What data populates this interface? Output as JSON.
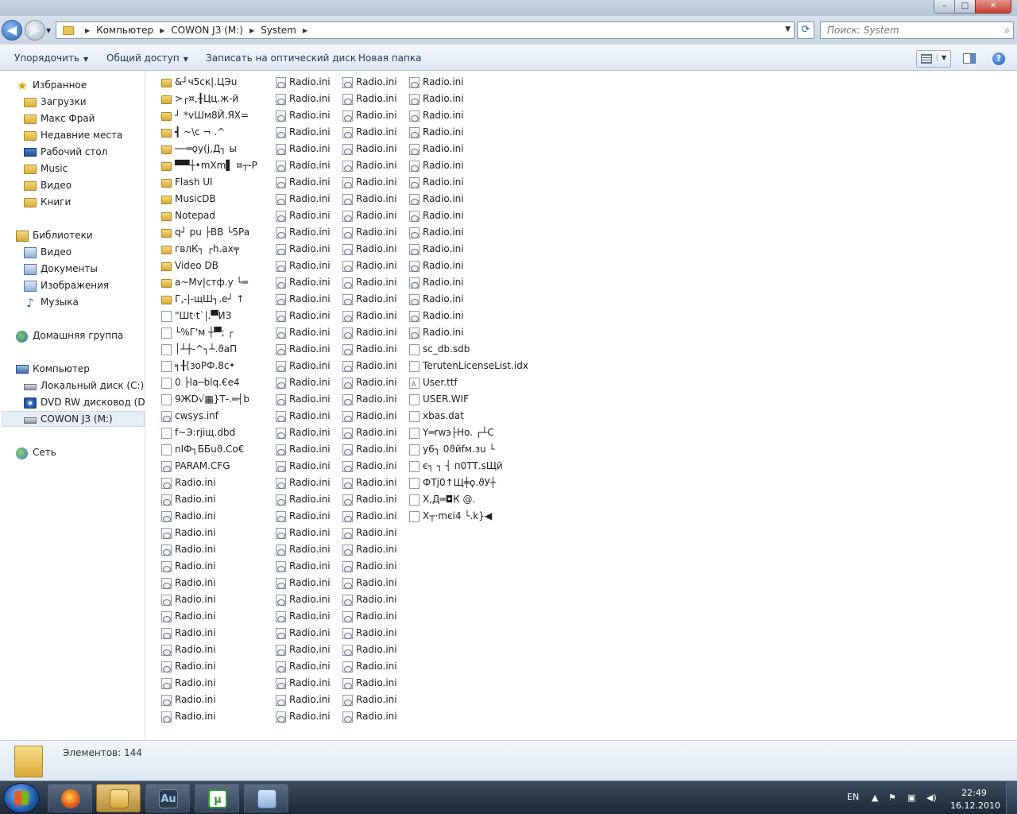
{
  "window": {
    "minimize_label": "–",
    "maximize_label": "□",
    "close_label": "✕"
  },
  "address": {
    "back_label": "◀",
    "forward_label": "▶",
    "crumbs": [
      "Компьютер",
      "COWON J3 (M:)",
      "System"
    ],
    "refresh_label": "⟳",
    "search_placeholder": "Поиск: System"
  },
  "toolbar": {
    "organize_label": "Упорядочить",
    "share_label": "Общий доступ",
    "burn_label": "Записать на оптический диск",
    "new_folder_label": "Новая папка",
    "help_label": "?"
  },
  "nav": {
    "favorites": {
      "label": "Избранное",
      "items": [
        "Загрузки",
        "Макс Фрай",
        "Недавние места",
        "Рабочий стол",
        "Music",
        "Видео",
        "Книги"
      ]
    },
    "libraries": {
      "label": "Библиотеки",
      "items": [
        "Видео",
        "Документы",
        "Изображения",
        "Музыка"
      ]
    },
    "homegroup": {
      "label": "Домашняя группа"
    },
    "computer": {
      "label": "Компьютер",
      "items": [
        "Локальный диск (C:)",
        "DVD RW дисковод (D:) C",
        "COWON J3 (M:)"
      ]
    },
    "network": {
      "label": "Сеть"
    }
  },
  "files": {
    "column1": [
      {
        "name": "&┘ч5ск|.ЦЭu",
        "type": "folder"
      },
      {
        "name": ">┌¤,╂Цц.ж-й",
        "type": "folder"
      },
      {
        "name": "┘ *vШм8Й.ЯХ=",
        "type": "folder"
      },
      {
        "name": "┫ ~\\с  ¬ .^",
        "type": "folder"
      },
      {
        "name": "──═ϙу(j,Д┐ ы",
        "type": "folder"
      },
      {
        "name": "▀▀┼•mXm▌ ¤┬-P",
        "type": "folder"
      },
      {
        "name": "Flash UI",
        "type": "folder"
      },
      {
        "name": "MusicDB",
        "type": "folder"
      },
      {
        "name": "Notepad",
        "type": "folder"
      },
      {
        "name": "q┘ pu ├BB └5Pa",
        "type": "folder"
      },
      {
        "name": "гвлК┐  ┌h.ах╤",
        "type": "folder"
      },
      {
        "name": "Video DB",
        "type": "folder"
      },
      {
        "name": "a~Mv|стф.у └═",
        "type": "folder"
      },
      {
        "name": "Г,-|-щШ┐.е┘ ↑",
        "type": "folder"
      },
      {
        "name": "\"Шt·t`|.▀ИЗ",
        "type": "doc"
      },
      {
        "name": "└%Г'м ┼▀; ┌",
        "type": "doc"
      },
      {
        "name": "│┴┼-^┐┴.ϑаП",
        "type": "doc"
      },
      {
        "name": "  ╕╂[зоРФ.8с•",
        "type": "doc"
      },
      {
        "name": "0 ├la─blq.€e4",
        "type": "doc"
      },
      {
        "name": "9ЖD√▦}Т-.═┤b",
        "type": "doc"
      },
      {
        "name": "cwsys.inf",
        "type": "cfg"
      },
      {
        "name": "f~Э:rjiщ.dbd",
        "type": "doc"
      },
      {
        "name": "nIФ┐ББuϑ.Со€",
        "type": "doc"
      },
      {
        "name": "PARAM.CFG",
        "type": "cfg"
      },
      {
        "name": "Radio.ini",
        "type": "cfg"
      },
      {
        "name": "Radio.ini",
        "type": "cfg"
      },
      {
        "name": "Radio.ini",
        "type": "cfg"
      },
      {
        "name": "Radio.ini",
        "type": "cfg"
      },
      {
        "name": "Radio.ini",
        "type": "cfg"
      },
      {
        "name": "Radio.ini",
        "type": "cfg"
      },
      {
        "name": "Radio.ini",
        "type": "cfg"
      },
      {
        "name": "Radio.ini",
        "type": "cfg"
      },
      {
        "name": "Radio.ini",
        "type": "cfg"
      },
      {
        "name": "Radio.ini",
        "type": "cfg"
      },
      {
        "name": "Radio.ini",
        "type": "cfg"
      },
      {
        "name": "Radio.ini",
        "type": "cfg"
      },
      {
        "name": "Radio.ini",
        "type": "cfg"
      },
      {
        "name": "Radio.ini",
        "type": "cfg"
      },
      {
        "name": "Radio.ini",
        "type": "cfg"
      }
    ],
    "column2_count": 39,
    "column3_count": 39,
    "column4": [
      {
        "name": "Radio.ini",
        "type": "cfg"
      },
      {
        "name": "Radio.ini",
        "type": "cfg"
      },
      {
        "name": "Radio.ini",
        "type": "cfg"
      },
      {
        "name": "Radio.ini",
        "type": "cfg"
      },
      {
        "name": "Radio.ini",
        "type": "cfg"
      },
      {
        "name": "Radio.ini",
        "type": "cfg"
      },
      {
        "name": "Radio.ini",
        "type": "cfg"
      },
      {
        "name": "Radio.ini",
        "type": "cfg"
      },
      {
        "name": "Radio.ini",
        "type": "cfg"
      },
      {
        "name": "Radio.ini",
        "type": "cfg"
      },
      {
        "name": "Radio.ini",
        "type": "cfg"
      },
      {
        "name": "Radio.ini",
        "type": "cfg"
      },
      {
        "name": "Radio.ini",
        "type": "cfg"
      },
      {
        "name": "Radio.ini",
        "type": "cfg"
      },
      {
        "name": "Radio.ini",
        "type": "cfg"
      },
      {
        "name": "Radio.ini",
        "type": "cfg"
      },
      {
        "name": "sc_db.sdb",
        "type": "doc"
      },
      {
        "name": "TerutenLicenseList.idx",
        "type": "doc"
      },
      {
        "name": "User.ttf",
        "type": "font"
      },
      {
        "name": "USER.WIF",
        "type": "doc"
      },
      {
        "name": "xbas.dat",
        "type": "doc"
      },
      {
        "name": "Y═rwэ├Ho. ┌┴С",
        "type": "doc"
      },
      {
        "name": "у6┐ 0ϑйfм.зu └",
        "type": "doc"
      },
      {
        "name": "є┐ ┐ ┤ п0ТТ.sЩй",
        "type": "doc"
      },
      {
        "name": "ФТj0↑Щ╪ϙ.ϑУ┼",
        "type": "doc"
      },
      {
        "name": "Х,Д═◘К @.",
        "type": "doc"
      },
      {
        "name": "Х┬·mєi4 └.k}◀",
        "type": "doc"
      }
    ],
    "repeated_name": "Radio.ini"
  },
  "details": {
    "count_label": "Элементов: 144"
  },
  "taskbar": {
    "apps": [
      "firefox",
      "explorer",
      "Au",
      "µ",
      "control"
    ],
    "au_label": "Au",
    "ut_label": "µ",
    "lang": "EN",
    "time": "22:49",
    "date": "16.12.2010"
  }
}
